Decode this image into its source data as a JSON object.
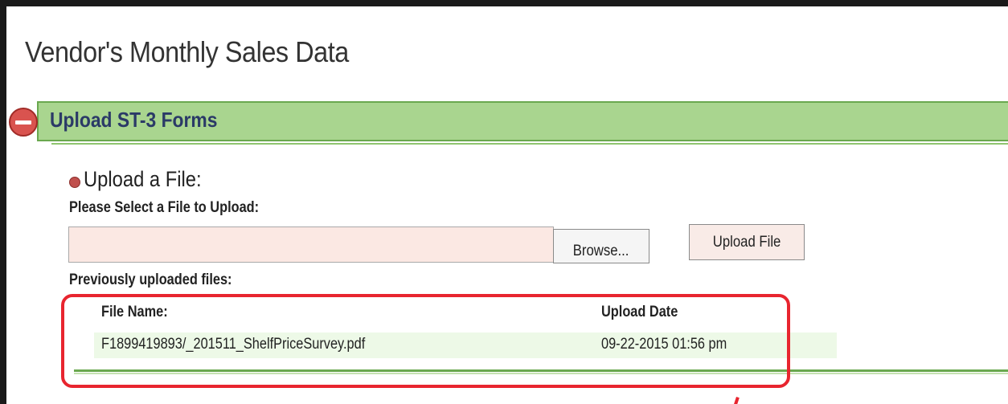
{
  "page": {
    "title": "Vendor's Monthly Sales Data"
  },
  "section": {
    "title": "Upload ST-3 Forms",
    "collapse_icon": "minus-circle-icon"
  },
  "upload": {
    "heading": "Upload a File:",
    "prompt": "Please Select a File to Upload:",
    "file_input_value": "",
    "browse_label": "Browse...",
    "upload_label": "Upload File"
  },
  "previous": {
    "label": "Previously uploaded files:",
    "columns": [
      "File Name:",
      "Upload Date"
    ],
    "rows": [
      {
        "file_name": "F1899419893/_201511_ShelfPriceSurvey.pdf",
        "upload_date": "09-22-2015 01:56 pm"
      }
    ]
  },
  "colors": {
    "section_bg": "#a9d58f",
    "annotation": "#e8252f",
    "input_bg": "#fbe8e3",
    "row_bg": "#edf9e7"
  }
}
